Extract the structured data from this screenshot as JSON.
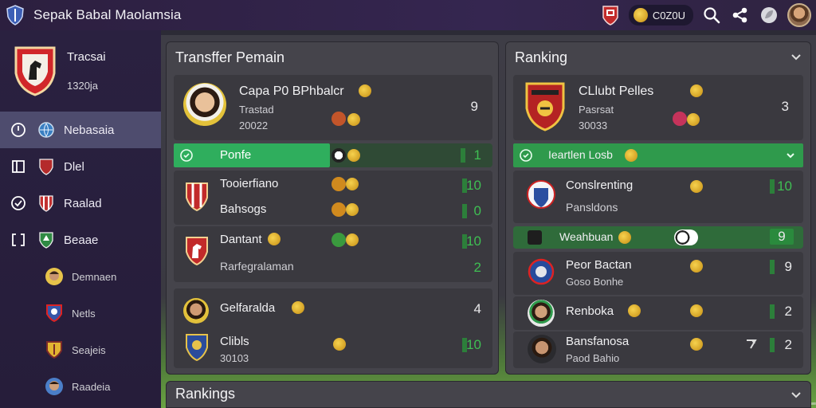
{
  "topbar": {
    "title": "Sepak Babal Maolamsia",
    "coins": "C0Z0U",
    "icons": [
      "shield-logo-icon",
      "club-flag-icon",
      "coin-icon",
      "search-icon",
      "share-icon",
      "leaf-icon",
      "user-avatar"
    ]
  },
  "sidebar": {
    "club_name": "Tracsai",
    "club_code": "1320ja",
    "items": [
      {
        "label": "Nebasaia",
        "icon": "clock-icon",
        "active": true
      },
      {
        "label": "Dlel",
        "icon": "door-icon"
      },
      {
        "label": "Raalad",
        "icon": "check-circle-icon"
      },
      {
        "label": "Beaae",
        "icon": "bracket-icon"
      },
      {
        "label": "Demnaen",
        "icon": "player-avatar"
      },
      {
        "label": "Netls",
        "icon": "crest-icon"
      },
      {
        "label": "Seajeis",
        "icon": "shield-icon"
      },
      {
        "label": "Raadeia",
        "icon": "player-avatar"
      }
    ]
  },
  "transfer": {
    "title": "Transffer Pemain",
    "featured": {
      "name": "Capa P0 BPhbalcr",
      "sub1": "Trastad",
      "sub2": "20022",
      "value": "9"
    },
    "highlight": {
      "label": "Ponfe",
      "value": "1"
    },
    "group1": {
      "rows": [
        {
          "name": "Tooierfiano",
          "value": "10"
        },
        {
          "name": "Bahsogs",
          "value": "0"
        }
      ]
    },
    "group2": {
      "rows": [
        {
          "name": "Dantant",
          "value": "10"
        },
        {
          "name": "Rarfegralaman",
          "value": "2"
        }
      ]
    },
    "group3": {
      "rows": [
        {
          "name": "Gelfaralda",
          "value": "4"
        },
        {
          "name": "Clibls",
          "sub": "30103",
          "value": "10"
        }
      ]
    }
  },
  "ranking": {
    "title": "Ranking",
    "featured": {
      "name": "CLlubt Pelles",
      "sub1": "Pasrsat",
      "sub2": "30033",
      "value": "3"
    },
    "highlight": {
      "label": "Ieartlen Losb"
    },
    "rows": [
      {
        "name": "Conslrenting",
        "sub": "Pansldons",
        "value": "10"
      },
      {
        "name": "Weahbuan",
        "value": "9",
        "highlight": true
      },
      {
        "name": "Peor Bactan",
        "sub": "Goso Bonhe",
        "value": "9"
      },
      {
        "name": "Renboka",
        "value": "2"
      },
      {
        "name": "Bansfanosa",
        "sub": "Paod Bahio",
        "value": "2"
      }
    ]
  },
  "bottom": {
    "title": "Rankings"
  }
}
